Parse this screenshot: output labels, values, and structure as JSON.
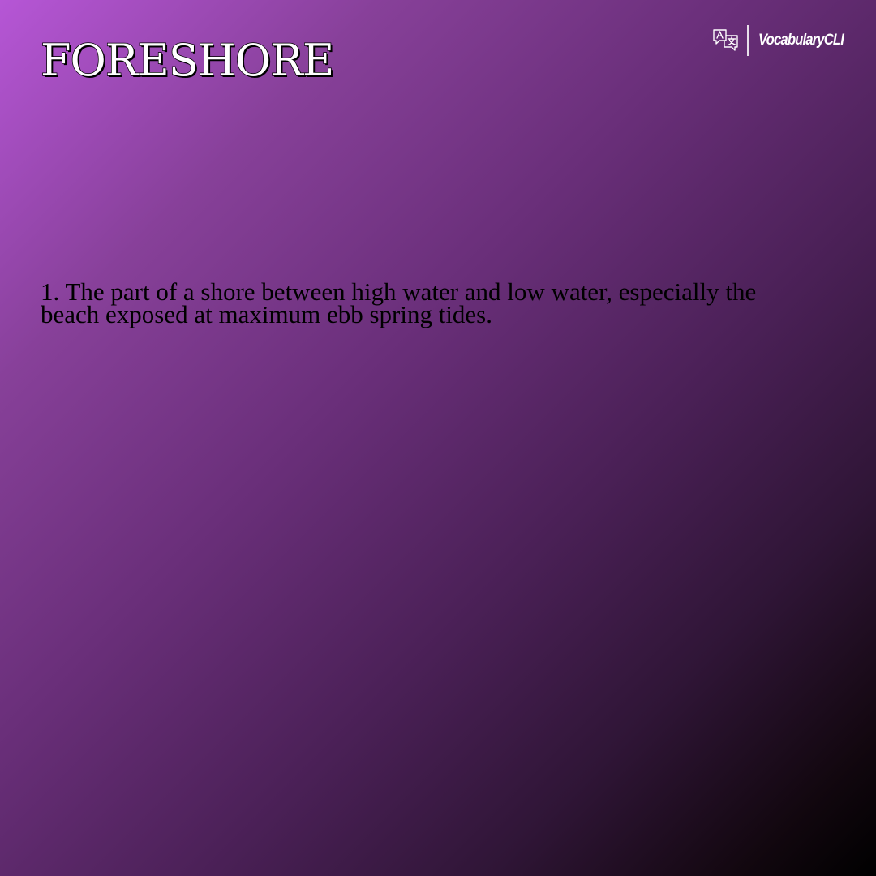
{
  "word": "FORESHORE",
  "brand": {
    "name": "VocabularyCLI",
    "icon": "translate-icon"
  },
  "definitions": [
    "1. The part of a shore between high water and low water, especially the beach exposed at maximum ebb spring tides."
  ],
  "colors": {
    "gradient_start": "#b656d6",
    "gradient_mid": "#6a2f7a",
    "gradient_end": "#000000",
    "word_fill": "#ffffff",
    "word_outline": "#000000",
    "definition_text": "#000000",
    "brand_text": "#ffffff"
  }
}
